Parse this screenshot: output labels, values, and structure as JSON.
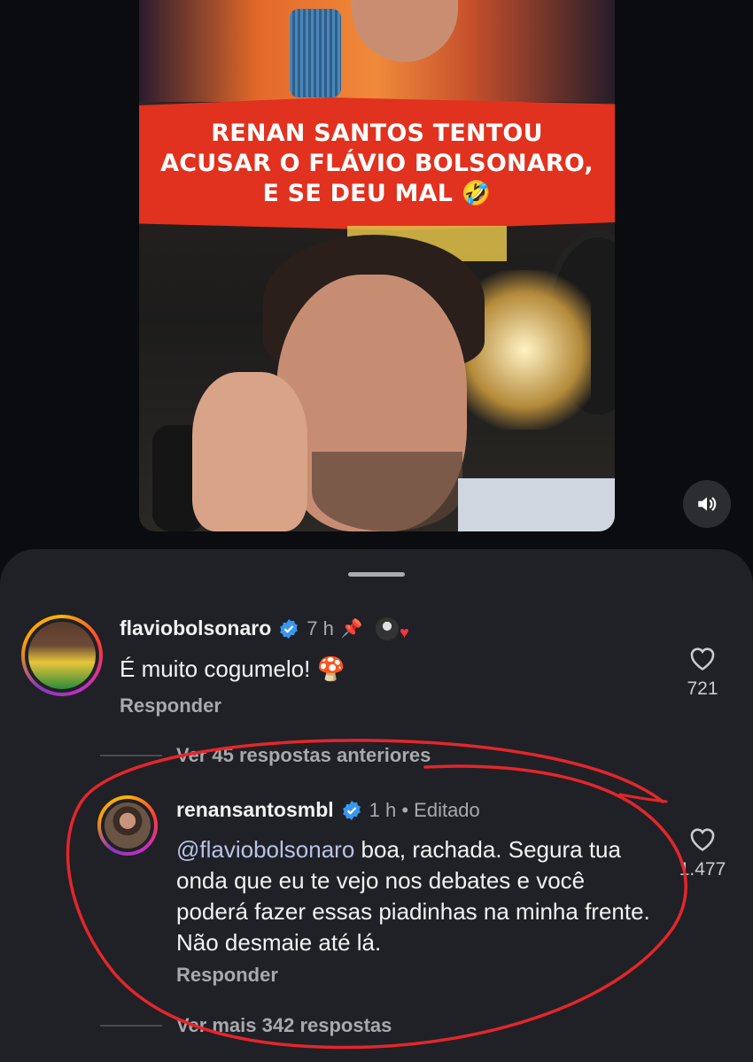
{
  "video": {
    "banner_text": "RENAN SANTOS TENTOU ACUSAR O FLÁVIO BOLSONARO, E SE DEU MAL 🤣"
  },
  "icons": {
    "sound": "volume-icon",
    "like": "heart-icon",
    "verified": "verified-badge-icon",
    "pin": "pin-icon"
  },
  "comments": [
    {
      "username": "flaviobolsonaro",
      "time": "7 h",
      "text": "É muito cogumelo! 🍄",
      "reply": "Responder",
      "likes": "721",
      "more_replies": "Ver 45 respostas anteriores"
    },
    {
      "username": "renansantosmbl",
      "time": "1 h • Editado",
      "mention": "@flaviobolsonaro",
      "text": " boa, rachada. Segura tua onda que eu te vejo nos debates e você poderá fazer essas piadinhas na minha frente. Não desmaie até lá.",
      "reply": "Responder",
      "likes": "1.477",
      "more_replies": "Ver mais 342 respostas"
    }
  ],
  "colors": {
    "sheet_bg": "#1f2126",
    "banner_red": "#e0321f",
    "annotation_red": "#e4262b",
    "verified_blue": "#3897f0"
  }
}
